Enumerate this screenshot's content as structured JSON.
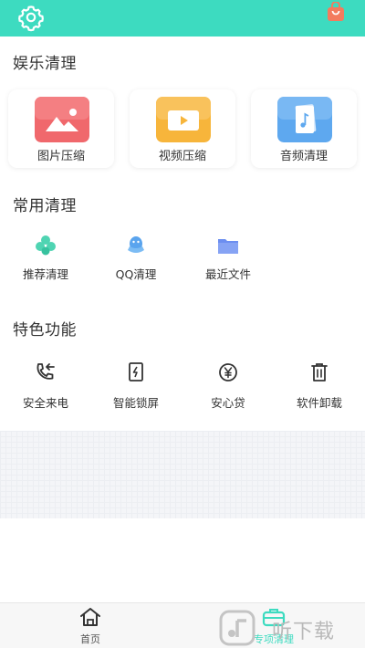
{
  "colors": {
    "accent": "#3ddbc0",
    "text": "#333333"
  },
  "header": {
    "settings_icon": "gear-icon",
    "shop_icon": "shopping-bag-icon"
  },
  "entertainment": {
    "title": "娱乐清理",
    "cards": [
      {
        "label": "图片压缩",
        "icon": "image-icon",
        "color": "#f0686c"
      },
      {
        "label": "视频压缩",
        "icon": "video-icon",
        "color": "#f7b53b"
      },
      {
        "label": "音频清理",
        "icon": "music-icon",
        "color": "#5ea8ef"
      }
    ]
  },
  "common": {
    "title": "常用清理",
    "items": [
      {
        "label": "推荐清理",
        "icon": "clover-icon"
      },
      {
        "label": "QQ清理",
        "icon": "qq-icon"
      },
      {
        "label": "最近文件",
        "icon": "folder-icon"
      }
    ]
  },
  "features": {
    "title": "特色功能",
    "items": [
      {
        "label": "安全来电",
        "icon": "phone-icon"
      },
      {
        "label": "智能锁屏",
        "icon": "lock-screen-icon"
      },
      {
        "label": "安心贷",
        "icon": "yuan-icon"
      },
      {
        "label": "软件卸载",
        "icon": "trash-icon"
      }
    ]
  },
  "tabbar": {
    "tabs": [
      {
        "label": "首页",
        "icon": "home-icon",
        "active": false
      },
      {
        "label": "专项清理",
        "icon": "briefcase-icon",
        "active": true
      }
    ]
  },
  "watermark": {
    "text": "听下载"
  }
}
